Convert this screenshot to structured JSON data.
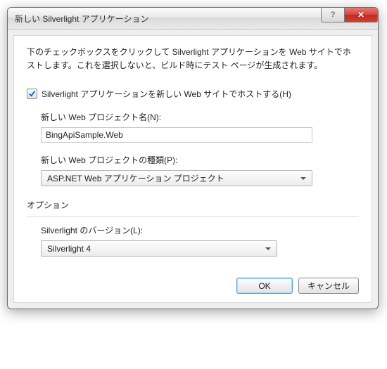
{
  "titlebar": {
    "title": "新しい Silverlight アプリケーション",
    "help_glyph": "?",
    "close_glyph": "✕"
  },
  "body": {
    "description": "下のチェックボックスをクリックして Silverlight アプリケーションを Web サイトでホストします。これを選択しないと、ビルド時にテスト ページが生成されます。",
    "host_checkbox_label": "Silverlight アプリケーションを新しい Web サイトでホストする(H)",
    "project_name_label": "新しい Web プロジェクト名(N):",
    "project_name_value": "BingApiSample.Web",
    "project_type_label": "新しい Web プロジェクトの種類(P):",
    "project_type_value": "ASP.NET Web アプリケーション プロジェクト",
    "options_label": "オプション",
    "version_label": "Silverlight のバージョン(L):",
    "version_value": "Silverlight 4"
  },
  "buttons": {
    "ok": "OK",
    "cancel": "キャンセル"
  }
}
